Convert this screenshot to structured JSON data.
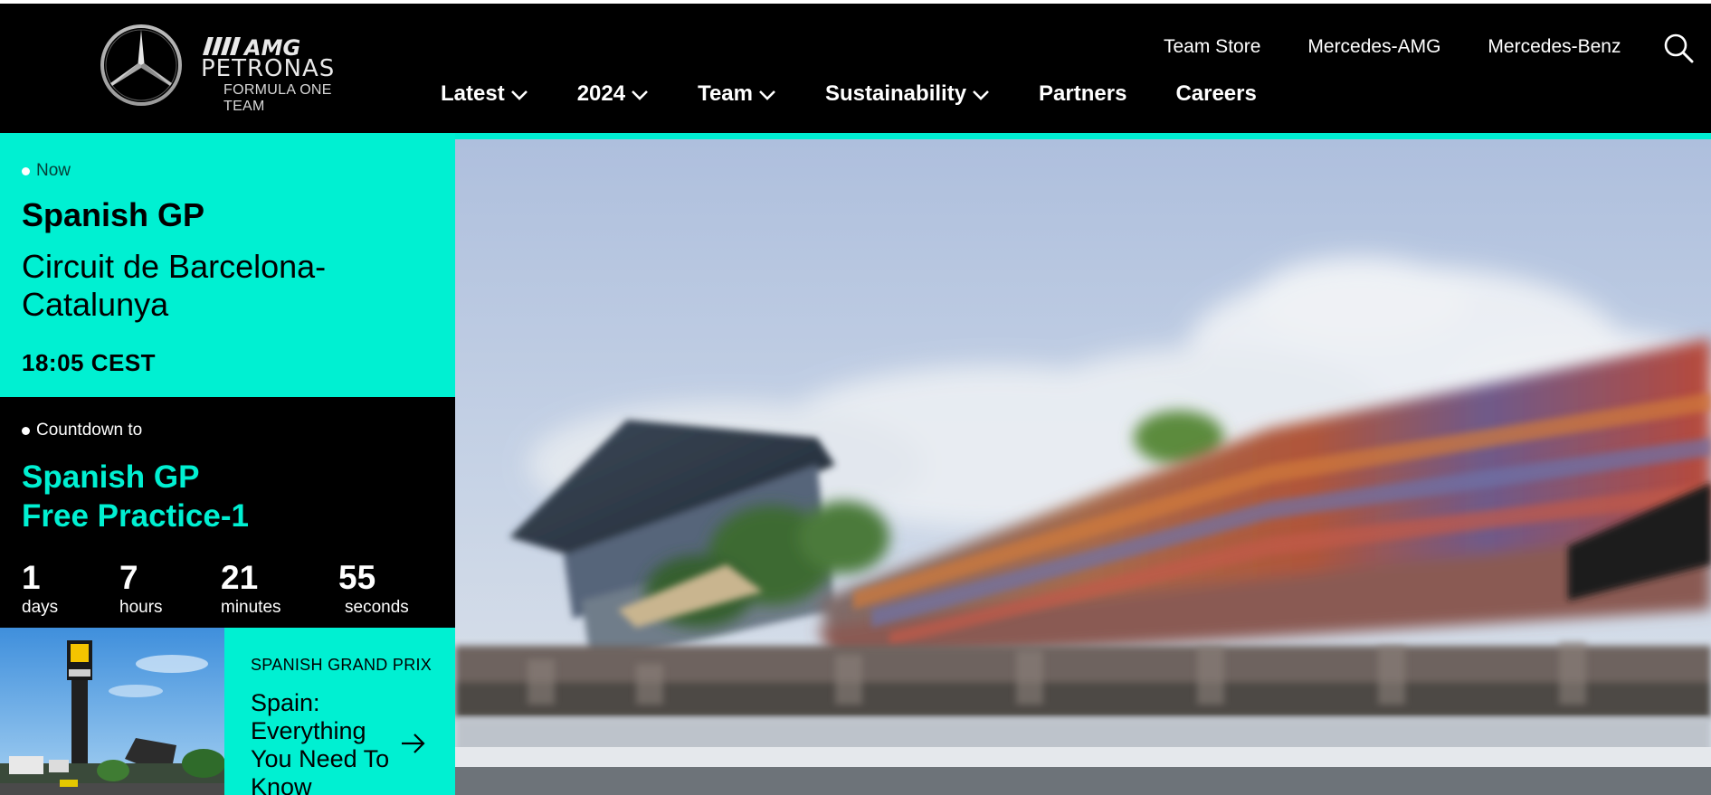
{
  "brand": {
    "amg": "AMG",
    "petronas": "PETRONAS",
    "team": "FORMULA ONE TEAM"
  },
  "header": {
    "top_links": [
      "Team Store",
      "Mercedes-AMG",
      "Mercedes-Benz"
    ],
    "nav": [
      {
        "label": "Latest",
        "dropdown": true
      },
      {
        "label": "2024",
        "dropdown": true
      },
      {
        "label": "Team",
        "dropdown": true
      },
      {
        "label": "Sustainability",
        "dropdown": true
      },
      {
        "label": "Partners",
        "dropdown": false
      },
      {
        "label": "Careers",
        "dropdown": false
      }
    ],
    "search_icon": "search-icon"
  },
  "now": {
    "label": "Now",
    "title": "Spanish GP",
    "circuit": "Circuit de Barcelona-Catalunya",
    "time": "18:05 CEST"
  },
  "countdown": {
    "label": "Countdown to",
    "title_line1": "Spanish GP",
    "title_line2": "Free Practice-1",
    "units": [
      {
        "value": "1",
        "label": "days"
      },
      {
        "value": "7",
        "label": "hours"
      },
      {
        "value": "21",
        "label": "minutes"
      },
      {
        "value": "55",
        "label": "seconds"
      }
    ]
  },
  "news": {
    "tag": "SPANISH GRAND PRIX",
    "title": "Spain: Everything You Need To Know"
  },
  "colors": {
    "teal": "#00f0d2",
    "black": "#000000"
  }
}
